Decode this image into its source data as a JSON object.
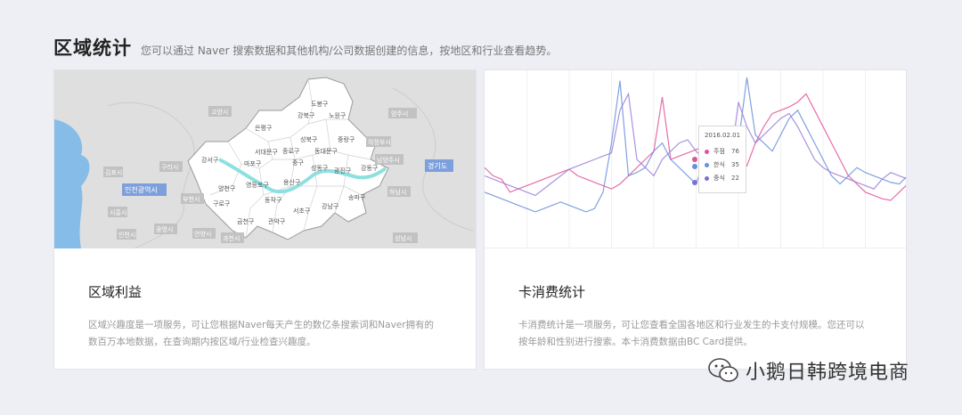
{
  "header": {
    "title": "区域统计",
    "subtitle": "您可以通过 Naver 搜索数据和其他机构/公司数据创建的信息，按地区和行业查看趋势。"
  },
  "cards": [
    {
      "title": "区域利益",
      "description": "区域兴趣度是一项服务，可让您根据Naver每天产生的数亿条搜索词和Naver拥有的数百万本地数据，在查询期内按区域/行业检查兴趣度。",
      "map": {
        "districts": [
          "도봉구",
          "강북구",
          "노원구",
          "은평구",
          "성북구",
          "중랑구",
          "서대문구",
          "종로구",
          "동대문구",
          "강서구",
          "마포구",
          "중구",
          "성동구",
          "광진구",
          "양천구",
          "영등포구",
          "용산구",
          "강동구",
          "구로구",
          "동작구",
          "서초구",
          "강남구",
          "송파구",
          "금천구",
          "관악구"
        ],
        "outer_tags": [
          "고양시",
          "양주시",
          "의정부시",
          "남양주시",
          "구리시",
          "하남시",
          "김포시",
          "부천시",
          "시흥시",
          "광명시",
          "안양시",
          "과천시",
          "성남시",
          "인천시"
        ],
        "blue_tags": [
          "인천광역시",
          "경기도"
        ]
      }
    },
    {
      "title": "卡消费统计",
      "description": "卡消费统计是一项服务，可让您查看全国各地区和行业发生的卡支付规模。您还可以按年龄和性别进行搜索。本卡消费数据由BC Card提供。",
      "tooltip": {
        "date": "2016.02.01",
        "rows": [
          {
            "name": "주점",
            "value": "76",
            "color": "#e0559a"
          },
          {
            "name": "한식",
            "value": "35",
            "color": "#6a8fdc"
          },
          {
            "name": "중식",
            "value": "22",
            "color": "#7a6fd6"
          }
        ]
      }
    }
  ],
  "chart_data": {
    "type": "line",
    "x": [
      0,
      1,
      2,
      3,
      4,
      5,
      6,
      7,
      8,
      9,
      10,
      11,
      12,
      13,
      14,
      15,
      16,
      17,
      18,
      19,
      20,
      21,
      22,
      23,
      24,
      25,
      26,
      27,
      28,
      29,
      30,
      31,
      32,
      33,
      34,
      35,
      36,
      37,
      38,
      39,
      40,
      41,
      42,
      43,
      44,
      45,
      46,
      47,
      48,
      49,
      50
    ],
    "ylim": [
      0,
      100
    ],
    "series": [
      {
        "color": "#e0559a",
        "values": [
          45,
          40,
          38,
          30,
          32,
          34,
          36,
          38,
          40,
          42,
          44,
          40,
          38,
          36,
          34,
          32,
          35,
          40,
          45,
          50,
          55,
          88,
          50,
          52,
          54,
          56,
          58,
          55,
          52,
          50,
          48,
          46,
          60,
          70,
          78,
          80,
          82,
          85,
          90,
          80,
          70,
          60,
          50,
          40,
          35,
          30,
          28,
          26,
          25,
          30,
          35
        ]
      },
      {
        "color": "#6a8fdc",
        "values": [
          30,
          28,
          26,
          24,
          22,
          20,
          18,
          20,
          22,
          24,
          22,
          20,
          18,
          20,
          30,
          60,
          98,
          40,
          42,
          45,
          55,
          60,
          50,
          45,
          40,
          35,
          50,
          55,
          50,
          45,
          60,
          100,
          65,
          60,
          55,
          65,
          75,
          80,
          70,
          60,
          50,
          40,
          35,
          40,
          45,
          42,
          40,
          38,
          36,
          35,
          40
        ]
      },
      {
        "color": "#9a7fd8",
        "values": [
          40,
          38,
          36,
          34,
          32,
          30,
          28,
          32,
          36,
          40,
          44,
          46,
          48,
          50,
          52,
          54,
          80,
          90,
          50,
          45,
          40,
          50,
          55,
          60,
          62,
          55,
          50,
          48,
          46,
          45,
          85,
          70,
          60,
          65,
          70,
          75,
          78,
          70,
          60,
          50,
          45,
          42,
          40,
          38,
          36,
          34,
          32,
          38,
          42,
          40,
          38
        ]
      }
    ]
  },
  "watermark": {
    "text": "小鹅日韩跨境电商"
  }
}
